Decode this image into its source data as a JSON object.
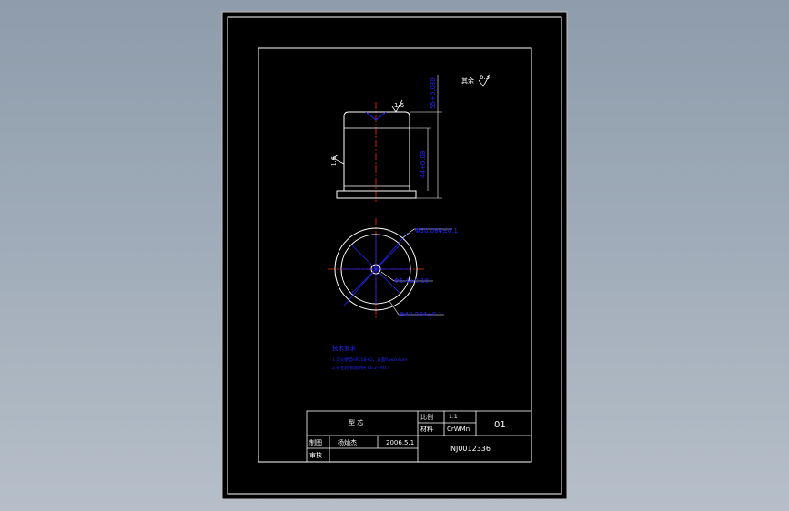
{
  "drawing": {
    "roughness_note": "其余",
    "roughness_main": "6.3",
    "roughness_top": "1.6",
    "roughness_side": "1.6",
    "dim_height_total": "55+0.030",
    "dim_height_body": "44+0.08",
    "dim_outer_dia": "Φ50.084±0.1",
    "dim_inner_dia": "Φ40.084±0.1",
    "dim_hole_dia": "Φ6.4±0.18"
  },
  "notes": {
    "title": "技术要求",
    "line1": "1.淬火硬度HRC58-62，表面Ra≤0.4um",
    "line2": "2.去毛刺 锐角倒钝 R0.2~R0.3"
  },
  "title_block": {
    "part_name": "型  芯",
    "scale_label": "比例",
    "scale_value": "1:1",
    "material_label": "材料",
    "material_value": "CrWMn",
    "sheet_no": "01",
    "drawn_label": "制图",
    "drawn_by": "杨灿杰",
    "date": "2006.5.1",
    "checked_label": "审核",
    "drawing_no": "NJ0012336"
  },
  "colors": {
    "background": "#9aa7b5",
    "sheet": "#000000",
    "lines": "#ffffff",
    "dimensions": "#2525ff",
    "centerline": "#ff2a00"
  }
}
